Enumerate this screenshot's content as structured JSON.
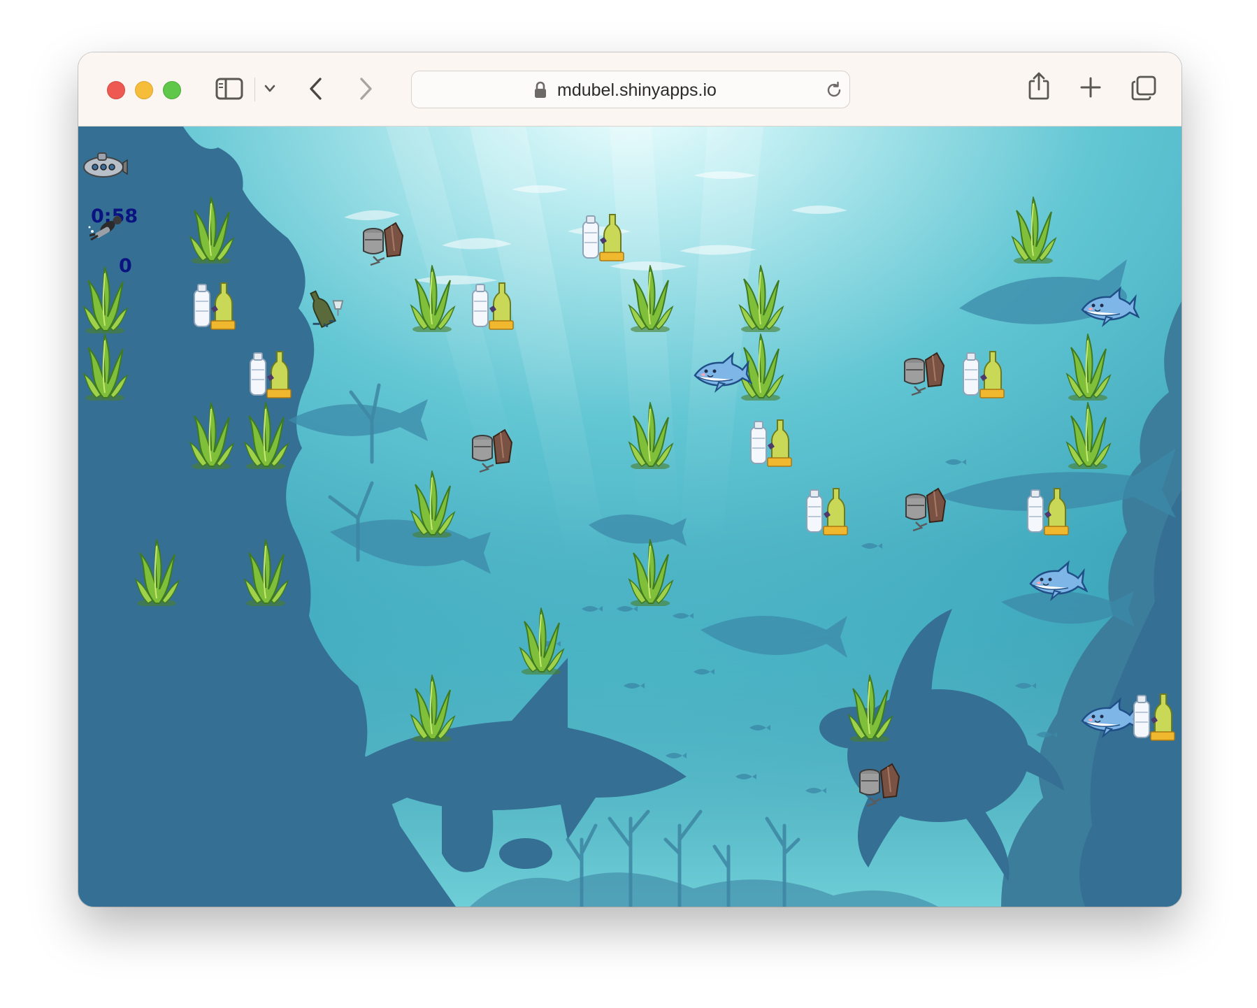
{
  "browser": {
    "url": "mdubel.shinyapps.io",
    "icons": [
      "sidebar-icon",
      "chevron-down-icon",
      "back-icon",
      "forward-icon",
      "lock-icon",
      "reload-icon",
      "share-icon",
      "new-tab-icon",
      "tabs-overview-icon"
    ]
  },
  "game": {
    "timer": "0:58",
    "score": "0",
    "colors": {
      "deep_water": "#3a6f93",
      "shallow_water": "#7fd8df",
      "hud_text": "#0b1380"
    },
    "sprites": [
      "submarine",
      "diver",
      "seaweed",
      "trash-bottles",
      "trash-can-bag",
      "shark",
      "bottle-glasses"
    ]
  }
}
